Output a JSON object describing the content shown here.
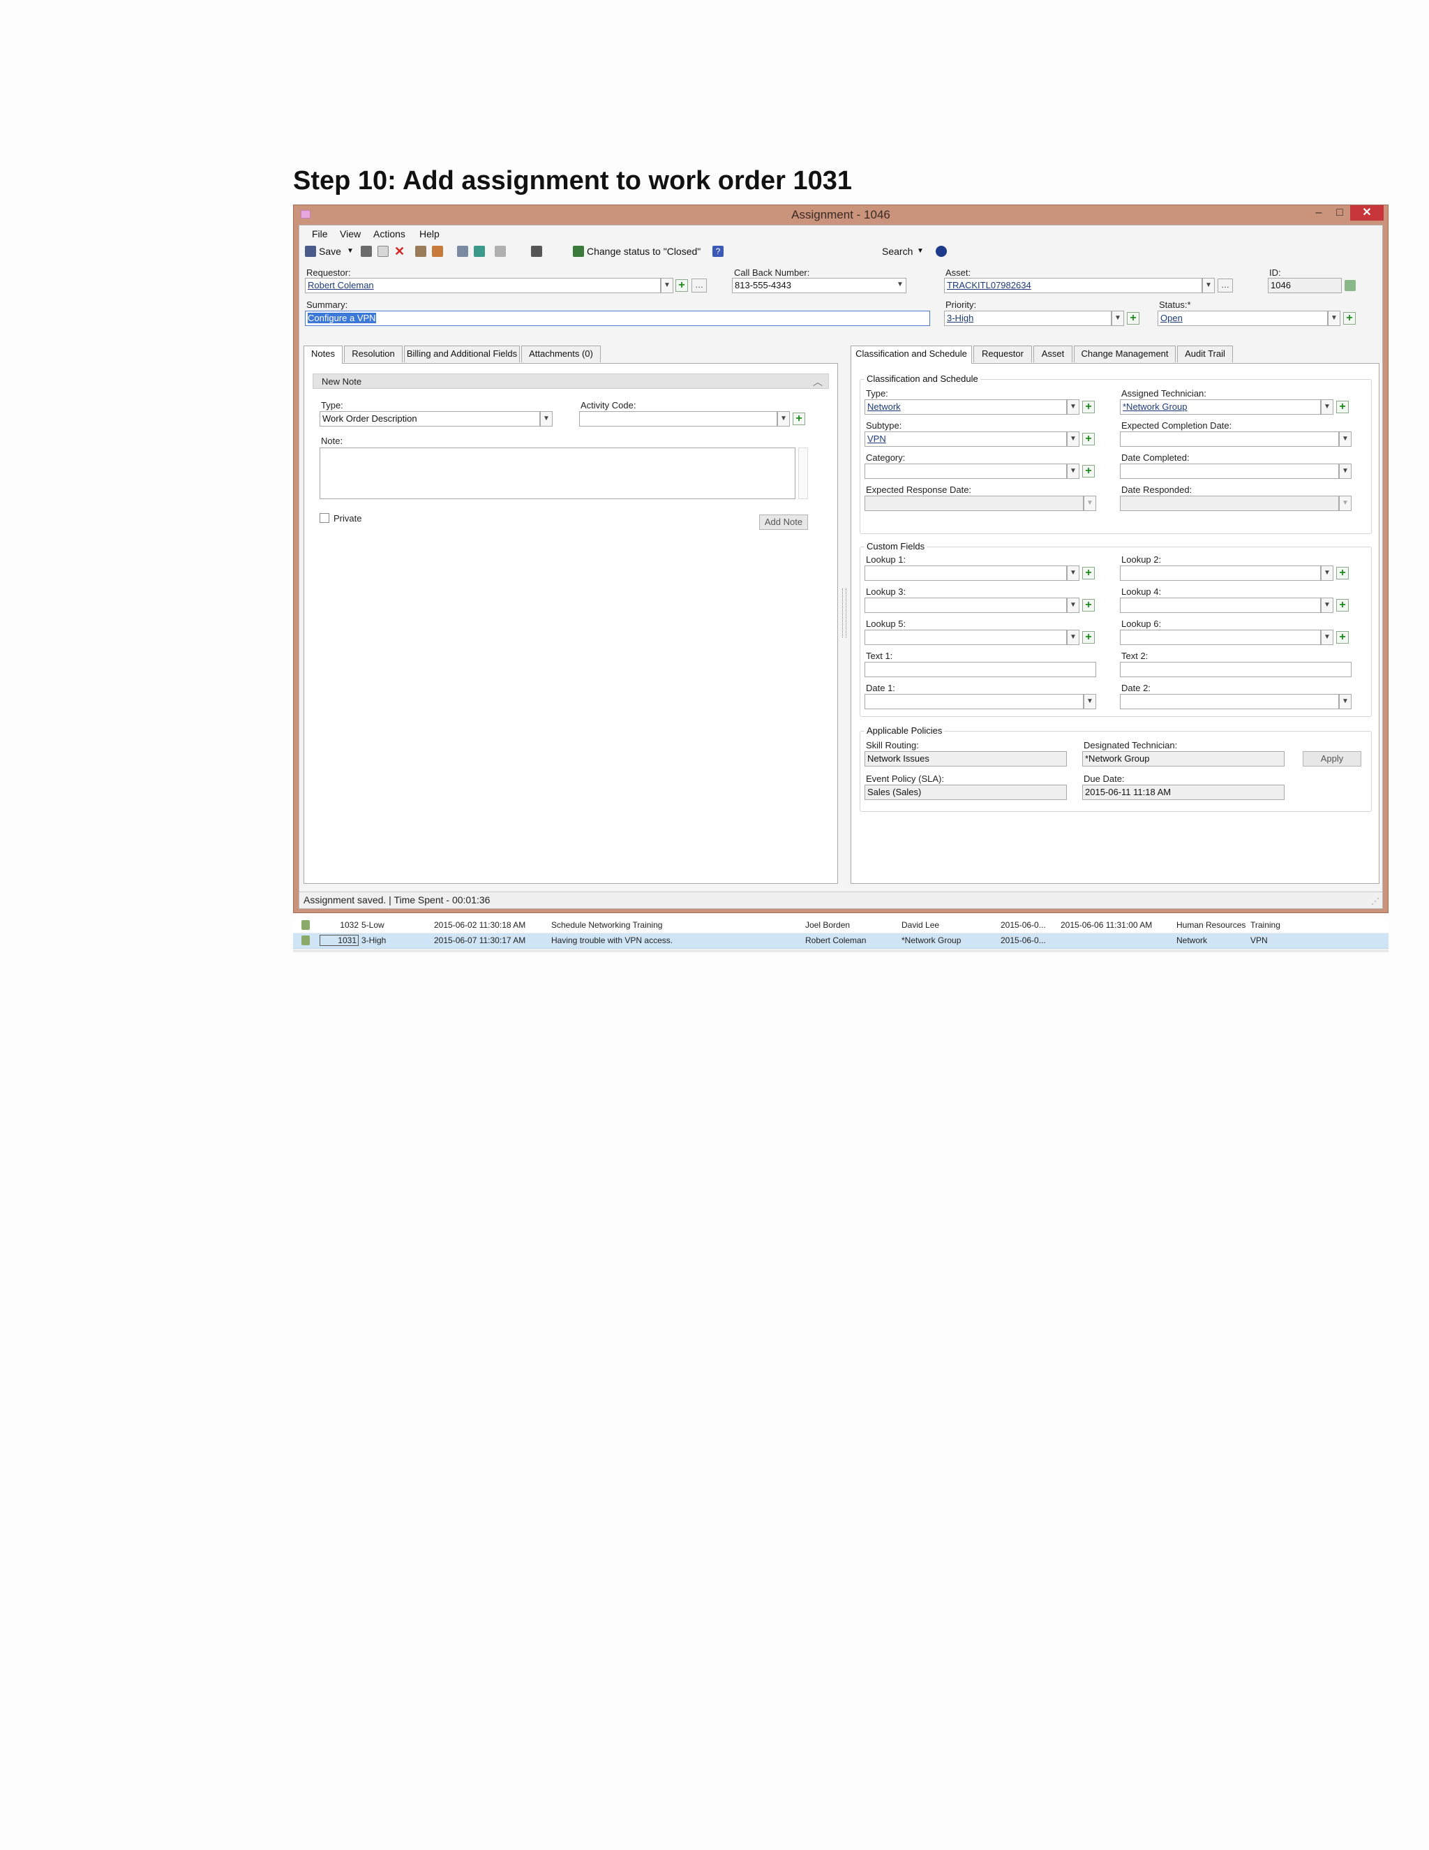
{
  "doc_title": "Step 10: Add assignment to work order 1031",
  "window": {
    "title": "Assignment - 1046",
    "min": "–",
    "max": "□",
    "close": "✕"
  },
  "menu": [
    "File",
    "View",
    "Actions",
    "Help"
  ],
  "toolbar": {
    "save": "Save",
    "change_status": "Change status to \"Closed\"",
    "search": "Search"
  },
  "header": {
    "requestor_label": "Requestor:",
    "requestor_value": "Robert Coleman",
    "callback_label": "Call Back Number:",
    "callback_value": "813-555-4343",
    "asset_label": "Asset:",
    "asset_value": "TRACKITL07982634",
    "id_label": "ID:",
    "id_value": "1046",
    "summary_label": "Summary:",
    "summary_value": "Configure a VPN",
    "priority_label": "Priority:",
    "priority_value": "3-High",
    "status_label": "Status:*",
    "status_value": "Open"
  },
  "left_tabs": [
    "Notes",
    "Resolution",
    "Billing and Additional Fields",
    "Attachments (0)"
  ],
  "note": {
    "header": "New Note",
    "type_label": "Type:",
    "type_value": "Work Order Description",
    "activity_label": "Activity Code:",
    "note_label": "Note:",
    "private_label": "Private",
    "add_button": "Add Note"
  },
  "right_tabs": [
    "Classification and Schedule",
    "Requestor",
    "Asset",
    "Change Management",
    "Audit Trail"
  ],
  "classification": {
    "title": "Classification and Schedule",
    "type_label": "Type:",
    "type_value": "Network",
    "assigned_label": "Assigned Technician:",
    "assigned_value": "*Network Group",
    "subtype_label": "Subtype:",
    "subtype_value": "VPN",
    "expected_completion_label": "Expected Completion Date:",
    "category_label": "Category:",
    "date_completed_label": "Date Completed:",
    "expected_response_label": "Expected Response Date:",
    "date_responded_label": "Date Responded:"
  },
  "custom": {
    "title": "Custom Fields",
    "lookup1": "Lookup 1:",
    "lookup2": "Lookup 2:",
    "lookup3": "Lookup 3:",
    "lookup4": "Lookup 4:",
    "lookup5": "Lookup 5:",
    "lookup6": "Lookup 6:",
    "text1": "Text 1:",
    "text2": "Text 2:",
    "date1": "Date 1:",
    "date2": "Date 2:"
  },
  "policies": {
    "title": "Applicable Policies",
    "skill_label": "Skill Routing:",
    "skill_value": "Network Issues",
    "designated_label": "Designated Technician:",
    "designated_value": "*Network Group",
    "apply_button": "Apply",
    "event_label": "Event Policy (SLA):",
    "event_value": "Sales (Sales)",
    "due_label": "Due Date:",
    "due_value": "2015-06-11 11:18 AM"
  },
  "status_bar": "Assignment saved. | Time Spent - 00:01:36",
  "grid_rows": [
    {
      "id": "1032",
      "priority": "5-Low",
      "opened": "2015-06-02 11:30:18 AM",
      "summary": "Schedule Networking Training",
      "requestor": "Joel Borden",
      "tech": "David Lee",
      "due": "2015-06-0...",
      "closed": "2015-06-06 11:31:00 AM",
      "type": "Human Resources",
      "subtype": "Training"
    },
    {
      "id": "1031",
      "priority": "3-High",
      "opened": "2015-06-07 11:30:17 AM",
      "summary": "Having trouble with VPN access.",
      "requestor": "Robert Coleman",
      "tech": "*Network Group",
      "due": "2015-06-0...",
      "closed": "",
      "type": "Network",
      "subtype": "VPN"
    }
  ]
}
